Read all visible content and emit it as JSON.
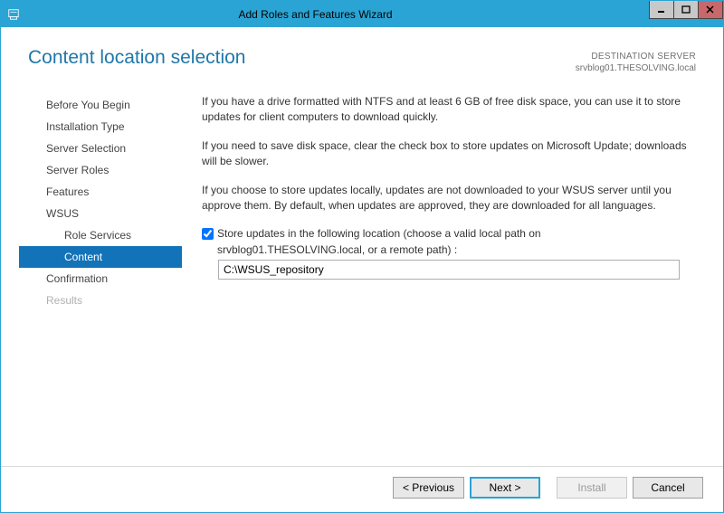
{
  "window": {
    "title": "Add Roles and Features Wizard"
  },
  "header": {
    "page_title": "Content location selection",
    "destination_label": "DESTINATION SERVER",
    "destination_server": "srvblog01.THESOLVING.local"
  },
  "sidebar": {
    "items": [
      {
        "label": "Before You Begin"
      },
      {
        "label": "Installation Type"
      },
      {
        "label": "Server Selection"
      },
      {
        "label": "Server Roles"
      },
      {
        "label": "Features"
      },
      {
        "label": "WSUS"
      },
      {
        "label": "Role Services"
      },
      {
        "label": "Content"
      },
      {
        "label": "Confirmation"
      },
      {
        "label": "Results"
      }
    ]
  },
  "main": {
    "para1": "If you have a drive formatted with NTFS and at least 6 GB of free disk space, you can use it to store updates for client computers to download quickly.",
    "para2": "If you need to save disk space, clear the check box to store updates on Microsoft Update; downloads will be slower.",
    "para3": "If you choose to store updates locally, updates are not downloaded to your WSUS server until you approve them. By default, when updates are approved, they are downloaded for all languages.",
    "checkbox_label_line1": "Store updates in the following location (choose a valid local path on",
    "checkbox_label_line2": "srvblog01.THESOLVING.local, or a remote path) :",
    "path_value": "C:\\WSUS_repository"
  },
  "footer": {
    "previous": "< Previous",
    "next": "Next >",
    "install": "Install",
    "cancel": "Cancel"
  }
}
